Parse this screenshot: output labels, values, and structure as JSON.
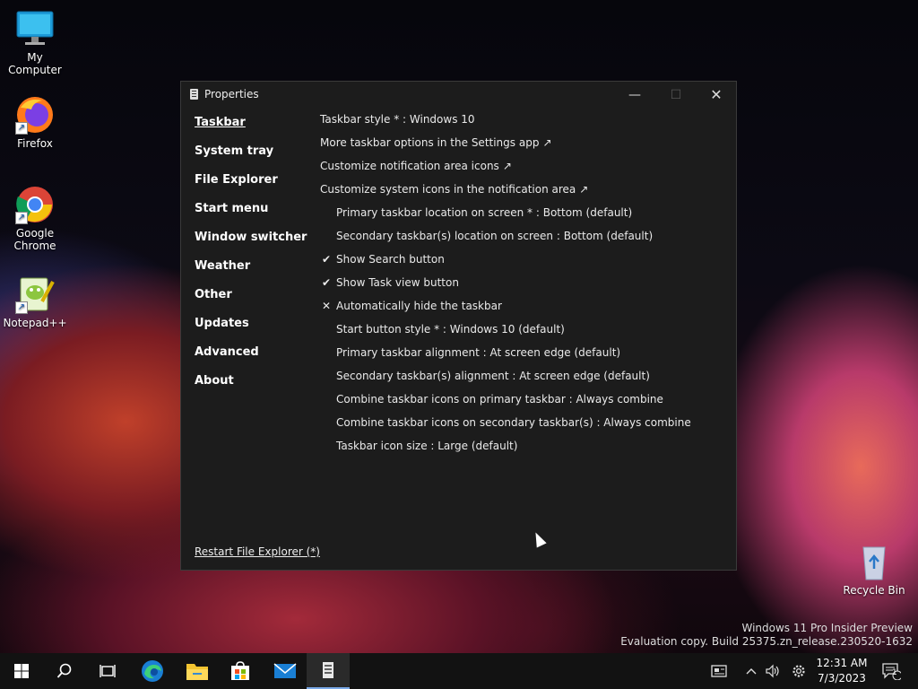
{
  "desktop": {
    "icons": [
      {
        "label": "My Computer",
        "icon": "monitor-icon"
      },
      {
        "label": "Firefox",
        "icon": "firefox-icon"
      },
      {
        "label": "Google Chrome",
        "icon": "chrome-icon"
      },
      {
        "label": "Notepad++",
        "icon": "notepad-plus-plus-icon"
      },
      {
        "label": "Recycle Bin",
        "icon": "recycle-bin-icon"
      }
    ]
  },
  "window": {
    "title": "Properties",
    "controls": {
      "minimize": "—",
      "maximize": "☐",
      "close": "✕"
    },
    "nav": [
      {
        "label": "Taskbar",
        "active": true
      },
      {
        "label": "System tray"
      },
      {
        "label": "File Explorer"
      },
      {
        "label": "Start menu"
      },
      {
        "label": "Window switcher"
      },
      {
        "label": "Weather"
      },
      {
        "label": "Other"
      },
      {
        "label": "Updates"
      },
      {
        "label": "Advanced"
      },
      {
        "label": "About"
      }
    ],
    "settings": [
      {
        "label": "Taskbar style * : Windows 10",
        "mark": "",
        "indent": false
      },
      {
        "label": "More taskbar options in the Settings app",
        "ext": "↗",
        "indent": false
      },
      {
        "label": "Customize notification area icons",
        "ext": "↗",
        "indent": false
      },
      {
        "label": "Customize system icons in the notification area",
        "ext": "↗",
        "indent": false
      },
      {
        "label": "Primary taskbar location on screen * : Bottom (default)",
        "indent": true
      },
      {
        "label": "Secondary taskbar(s) location on screen : Bottom (default)",
        "indent": true
      },
      {
        "label": "Show Search button",
        "mark": "✔",
        "indent": true
      },
      {
        "label": "Show Task view button",
        "mark": "✔",
        "indent": true
      },
      {
        "label": "Automatically hide the taskbar",
        "mark": "✕",
        "indent": true
      },
      {
        "label": "Start button style * : Windows 10 (default)",
        "indent": true
      },
      {
        "label": "Primary taskbar alignment : At screen edge (default)",
        "indent": true
      },
      {
        "label": "Secondary taskbar(s) alignment : At screen edge (default)",
        "indent": true
      },
      {
        "label": "Combine taskbar icons on primary taskbar : Always combine",
        "indent": true
      },
      {
        "label": "Combine taskbar icons on secondary taskbar(s) : Always combine",
        "indent": true
      },
      {
        "label": "Taskbar icon size : Large (default)",
        "indent": true
      }
    ],
    "restart_link": "Restart File Explorer (*)"
  },
  "watermark": {
    "line1": "Windows 11 Pro Insider Preview",
    "line2": "Evaluation copy. Build 25375.zn_release.230520-1632"
  },
  "taskbar": {
    "buttons": [
      {
        "name": "start-button",
        "icon": "windows-logo-icon"
      },
      {
        "name": "search-button",
        "icon": "search-icon"
      },
      {
        "name": "task-view-button",
        "icon": "task-view-icon"
      },
      {
        "name": "edge-button",
        "icon": "edge-icon"
      },
      {
        "name": "file-explorer-button",
        "icon": "folder-icon"
      },
      {
        "name": "store-button",
        "icon": "store-icon"
      },
      {
        "name": "mail-button",
        "icon": "mail-icon"
      },
      {
        "name": "properties-app-button",
        "icon": "properties-icon",
        "active": true
      }
    ],
    "clock": {
      "time": "12:31 AM",
      "date": "7/3/2023"
    },
    "notification_count": "1"
  },
  "colors": {
    "accent": "#7aa9e8",
    "window_bg": "#1c1c1c",
    "taskbar_bg": "#121212"
  }
}
